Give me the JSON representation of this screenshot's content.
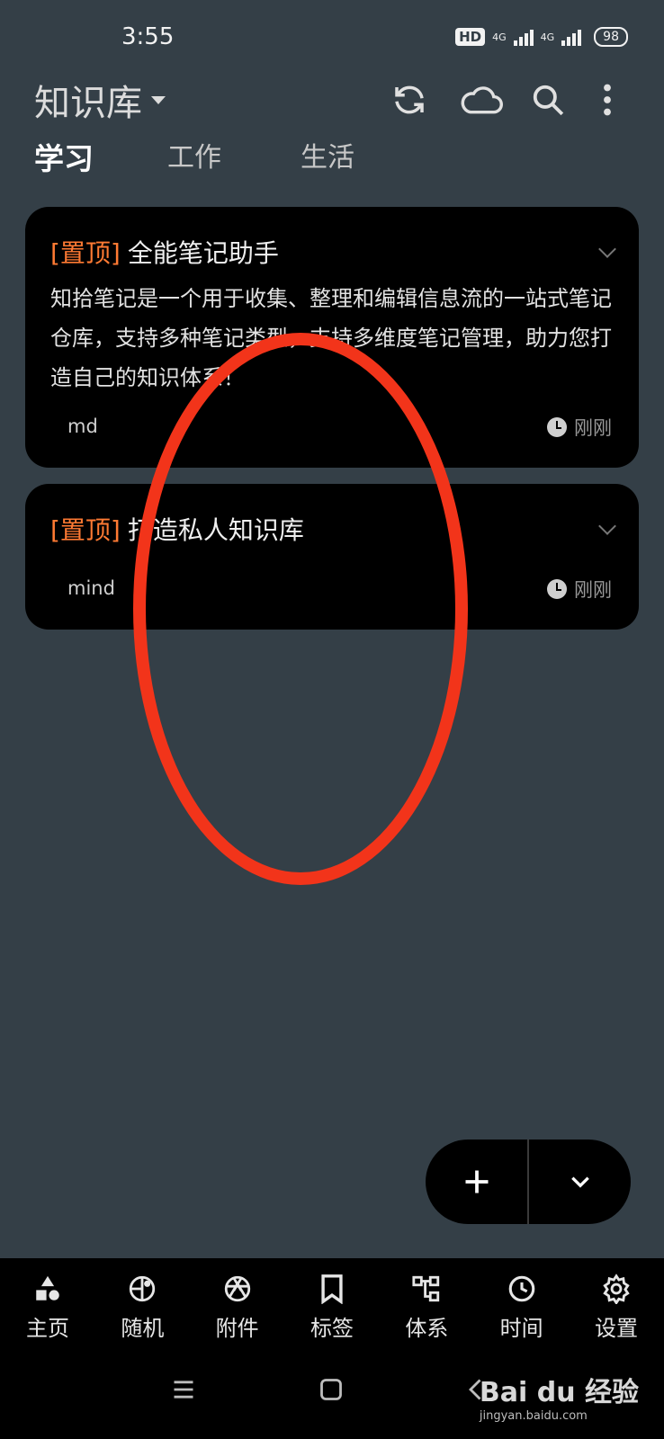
{
  "status_bar": {
    "time": "3:55",
    "hd": "HD",
    "net1": "4G",
    "net2": "4G",
    "battery": "98"
  },
  "header": {
    "title": "知识库",
    "icons": [
      "sync-icon",
      "cloud-icon",
      "search-icon",
      "more-vertical-icon"
    ]
  },
  "tabs": [
    {
      "label": "学习",
      "active": true
    },
    {
      "label": "工作",
      "active": false
    },
    {
      "label": "生活",
      "active": false
    }
  ],
  "notes": [
    {
      "pin": "[置顶]",
      "title": "全能笔记助手",
      "body": "知拾笔记是一个用于收集、整理和编辑信息流的一站式笔记仓库，支持多种笔记类型，支持多维度笔记管理，助力您打造自己的知识体系！",
      "type": "md",
      "time": "刚刚"
    },
    {
      "pin": "[置顶]",
      "title": "打造私人知识库",
      "body": "",
      "type": "mind",
      "time": "刚刚"
    }
  ],
  "fab": {
    "add_icon": "plus-icon",
    "expand_icon": "chevron-down-icon"
  },
  "bottom_nav": [
    {
      "label": "主页",
      "icon": "shapes-icon"
    },
    {
      "label": "随机",
      "icon": "dice-icon"
    },
    {
      "label": "附件",
      "icon": "aperture-icon"
    },
    {
      "label": "标签",
      "icon": "bookmark-icon"
    },
    {
      "label": "体系",
      "icon": "hierarchy-icon"
    },
    {
      "label": "时间",
      "icon": "clock-icon"
    },
    {
      "label": "设置",
      "icon": "gear-icon"
    }
  ],
  "watermark": {
    "main": "Bai du 经验",
    "sub": "jingyan.baidu.com"
  },
  "colors": {
    "background": "#343f47",
    "card": "#000000",
    "pin": "#ff7a33",
    "annotation": "#f2341a"
  }
}
